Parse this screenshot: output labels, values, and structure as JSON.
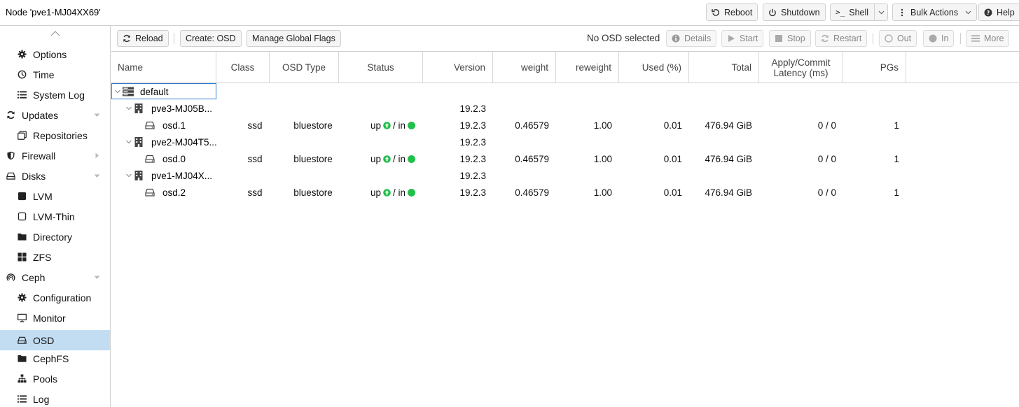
{
  "header": {
    "title": "Node 'pve1-MJ04XX69'",
    "buttons": {
      "reboot": "Reboot",
      "shutdown": "Shutdown",
      "shell": "Shell",
      "bulk_actions": "Bulk Actions",
      "help": "Help"
    }
  },
  "sidebar": {
    "items": [
      {
        "label": "Options",
        "icon": "gear-icon"
      },
      {
        "label": "Time",
        "icon": "clock-icon"
      },
      {
        "label": "System Log",
        "icon": "list-icon"
      },
      {
        "label": "Updates",
        "icon": "refresh-icon"
      },
      {
        "label": "Repositories",
        "icon": "repositories-icon"
      },
      {
        "label": "Firewall",
        "icon": "shield-icon"
      },
      {
        "label": "Disks",
        "icon": "drive-icon"
      },
      {
        "label": "LVM",
        "icon": "square-filled-icon"
      },
      {
        "label": "LVM-Thin",
        "icon": "square-outline-icon"
      },
      {
        "label": "Directory",
        "icon": "folder-icon"
      },
      {
        "label": "ZFS",
        "icon": "grid-icon"
      },
      {
        "label": "Ceph",
        "icon": "ceph-icon"
      },
      {
        "label": "Configuration",
        "icon": "gear-icon"
      },
      {
        "label": "Monitor",
        "icon": "monitor-icon"
      },
      {
        "label": "OSD",
        "icon": "drive-icon"
      },
      {
        "label": "CephFS",
        "icon": "folder-icon"
      },
      {
        "label": "Pools",
        "icon": "sitemap-icon"
      },
      {
        "label": "Log",
        "icon": "list-icon"
      }
    ],
    "active": "OSD"
  },
  "toolbar": {
    "reload": "Reload",
    "create_osd": "Create: OSD",
    "manage_flags": "Manage Global Flags",
    "selection_status": "No OSD selected",
    "details": "Details",
    "start": "Start",
    "stop": "Stop",
    "restart": "Restart",
    "out": "Out",
    "in": "In",
    "more": "More"
  },
  "grid": {
    "columns": {
      "name": "Name",
      "class": "Class",
      "osd_type": "OSD Type",
      "status": "Status",
      "version": "Version",
      "weight": "weight",
      "reweight": "reweight",
      "used": "Used (%)",
      "total": "Total",
      "latency_line1": "Apply/Commit",
      "latency_line2": "Latency (ms)",
      "pgs": "PGs"
    },
    "rows": [
      {
        "name": "default",
        "type": "root"
      },
      {
        "name": "pve3-MJ05B...",
        "type": "host",
        "version": "19.2.3"
      },
      {
        "name": "osd.1",
        "type": "osd",
        "class": "ssd",
        "osd_type": "bluestore",
        "status_up": "up",
        "status_sep": "/ in",
        "version": "19.2.3",
        "weight": "0.46579",
        "reweight": "1.00",
        "used": "0.01",
        "total": "476.94 GiB",
        "latency": "0 / 0",
        "pgs": "1"
      },
      {
        "name": "pve2-MJ04T5...",
        "type": "host",
        "version": "19.2.3"
      },
      {
        "name": "osd.0",
        "type": "osd",
        "class": "ssd",
        "osd_type": "bluestore",
        "status_up": "up",
        "status_sep": "/ in",
        "version": "19.2.3",
        "weight": "0.46579",
        "reweight": "1.00",
        "used": "0.01",
        "total": "476.94 GiB",
        "latency": "0 / 0",
        "pgs": "1"
      },
      {
        "name": "pve1-MJ04X...",
        "type": "host",
        "version": "19.2.3"
      },
      {
        "name": "osd.2",
        "type": "osd",
        "class": "ssd",
        "osd_type": "bluestore",
        "status_up": "up",
        "status_sep": "/ in",
        "version": "19.2.3",
        "weight": "0.46579",
        "reweight": "1.00",
        "used": "0.01",
        "total": "476.94 GiB",
        "latency": "0 / 0",
        "pgs": "1"
      }
    ]
  },
  "colors": {
    "active_bg": "#c2ddf2",
    "status_green": "#21bf4b",
    "selection_border": "#2e7bcf"
  }
}
